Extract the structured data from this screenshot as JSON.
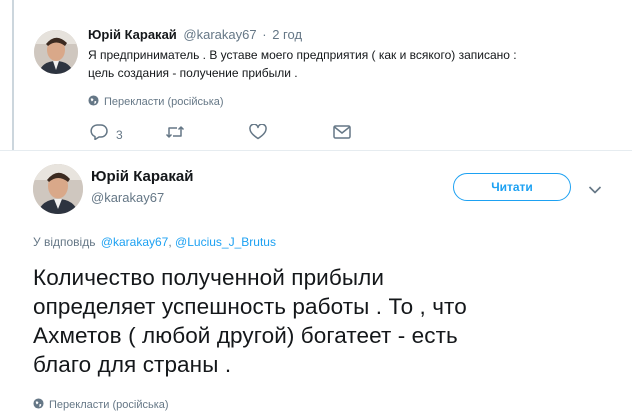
{
  "reply_tweet": {
    "author_name": "Юрій Каракай",
    "handle": "@karakay67",
    "separator": "·",
    "time": "2 год",
    "text_line1": "Я предприниматель . В уставе моего предприятия ( как и всякого) записано :",
    "text_line2": "цель создания  - получение прибыли .",
    "translate_label": "Перекласти (російська)",
    "reply_count": "3"
  },
  "main_tweet": {
    "author_name": "Юрій Каракай",
    "handle": "@karakay67",
    "follow_label": "Читати",
    "reply_to_prefix": "У відповідь",
    "reply_to_user1": "@karakay67",
    "reply_to_sep": ",",
    "reply_to_user2": "@Lucius_J_Brutus",
    "text_line1": "Количество полученной прибыли",
    "text_line2": "определяет успешность работы . То , что",
    "text_line3": "Ахметов ( любой другой) богатеет - есть",
    "text_line4": "благо для страны .",
    "translate_label": "Перекласти (російська)"
  },
  "colors": {
    "accent": "#1da1f2",
    "muted": "#657786",
    "text": "#14171a"
  },
  "icons": [
    "globe-icon",
    "reply-icon",
    "retweet-icon",
    "like-icon",
    "message-icon",
    "chevron-down-icon"
  ]
}
